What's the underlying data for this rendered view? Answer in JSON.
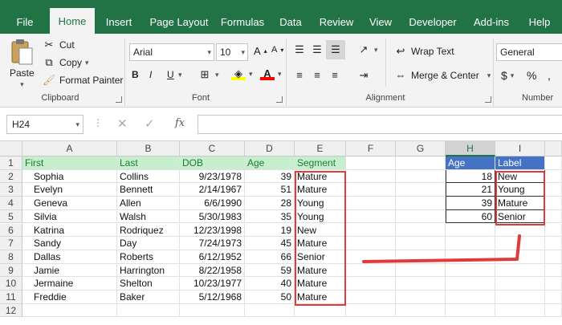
{
  "ribbon_tabs": [
    "File",
    "Home",
    "Insert",
    "Page Layout",
    "Formulas",
    "Data",
    "Review",
    "View",
    "Developer",
    "Add-ins",
    "Help"
  ],
  "clipboard": {
    "paste": "Paste",
    "cut": "Cut",
    "copy": "Copy",
    "format_painter": "Format Painter",
    "label": "Clipboard"
  },
  "font": {
    "name": "Arial",
    "size": "10",
    "bold": "B",
    "italic": "I",
    "underline": "U",
    "label": "Font"
  },
  "alignment": {
    "wrap_text": "Wrap Text",
    "merge_center": "Merge & Center",
    "label": "Alignment"
  },
  "number": {
    "format": "General",
    "currency": "$",
    "percent": "%",
    "label": "Number"
  },
  "formula_bar": {
    "name_box": "H24",
    "fx": "fx",
    "value": ""
  },
  "columns": [
    "A",
    "B",
    "C",
    "D",
    "E",
    "F",
    "G",
    "H",
    "I"
  ],
  "rows": [
    "1",
    "2",
    "3",
    "4",
    "5",
    "6",
    "7",
    "8",
    "9",
    "10",
    "11",
    "12"
  ],
  "table_headers": [
    "First",
    "Last",
    "DOB",
    "Age",
    "Segment"
  ],
  "table_rows": [
    [
      "Sophia",
      "Collins",
      "9/23/1978",
      "39",
      "Mature"
    ],
    [
      "Evelyn",
      "Bennett",
      "2/14/1967",
      "51",
      "Mature"
    ],
    [
      "Geneva",
      "Allen",
      "6/6/1990",
      "28",
      "Young"
    ],
    [
      "Silvia",
      "Walsh",
      "5/30/1983",
      "35",
      "Young"
    ],
    [
      "Katrina",
      "Rodriquez",
      "12/23/1998",
      "19",
      "New"
    ],
    [
      "Sandy",
      "Day",
      "7/24/1973",
      "45",
      "Mature"
    ],
    [
      "Dallas",
      "Roberts",
      "6/12/1952",
      "66",
      "Senior"
    ],
    [
      "Jamie",
      "Harrington",
      "8/22/1958",
      "59",
      "Mature"
    ],
    [
      "Jermaine",
      "Shelton",
      "10/23/1977",
      "40",
      "Mature"
    ],
    [
      "Freddie",
      "Baker",
      "5/12/1968",
      "50",
      "Mature"
    ]
  ],
  "lookup_headers": [
    "Age",
    "Label"
  ],
  "lookup_rows": [
    [
      "18",
      "New"
    ],
    [
      "21",
      "Young"
    ],
    [
      "39",
      "Mature"
    ],
    [
      "60",
      "Senior"
    ]
  ],
  "colors": {
    "excel_green": "#217346",
    "header_green": "#c6efce",
    "header_blue": "#4472c4",
    "annotation_red": "#e03a3a"
  }
}
